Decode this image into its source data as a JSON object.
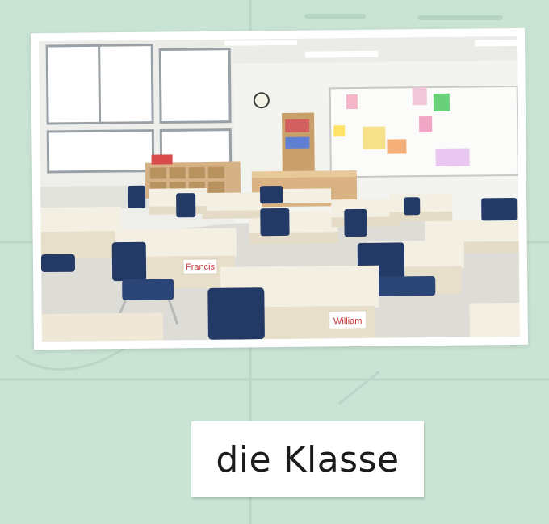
{
  "caption": {
    "text": "die Klasse"
  },
  "photo": {
    "description_icon": "classroom-photo",
    "name_tags": [
      "Francis",
      "William"
    ]
  },
  "colors": {
    "background": "#c9e3d4",
    "card": "#ffffff",
    "chair": "#243a66",
    "desk_top": "#f1ecdf",
    "desk_body": "#e7dfc9"
  }
}
